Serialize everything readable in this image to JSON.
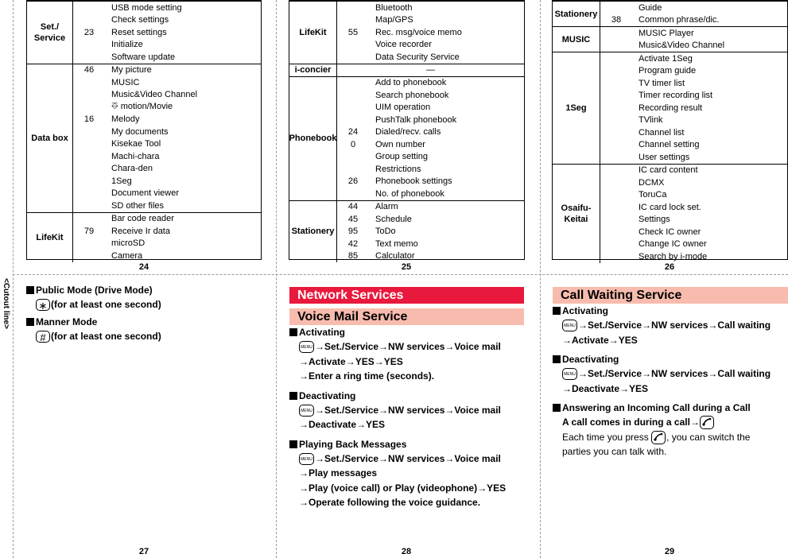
{
  "side_label": "<Cutout line>",
  "pages": {
    "p24": {
      "number": "24",
      "groups": [
        {
          "category": "Set./\nService",
          "rows": [
            {
              "num": "",
              "item": "USB mode setting"
            },
            {
              "num": "",
              "item": "Check settings"
            },
            {
              "num": "23",
              "item": "Reset settings"
            },
            {
              "num": "",
              "item": "Initialize"
            },
            {
              "num": "",
              "item": "Software update"
            }
          ]
        },
        {
          "category": "Data box",
          "rows": [
            {
              "num": "46",
              "item": "My picture"
            },
            {
              "num": "",
              "item": "MUSIC"
            },
            {
              "num": "",
              "item": "Music&Video Channel"
            },
            {
              "num": "",
              "item": "⎑ motion/Movie"
            },
            {
              "num": "16",
              "item": "Melody"
            },
            {
              "num": "",
              "item": "My documents"
            },
            {
              "num": "",
              "item": "Kisekae Tool"
            },
            {
              "num": "",
              "item": "Machi-chara"
            },
            {
              "num": "",
              "item": "Chara-den"
            },
            {
              "num": "",
              "item": "1Seg"
            },
            {
              "num": "",
              "item": "Document viewer"
            },
            {
              "num": "",
              "item": "SD other files"
            }
          ]
        },
        {
          "category": "LifeKit",
          "rows": [
            {
              "num": "",
              "item": "Bar code reader"
            },
            {
              "num": "79",
              "item": "Receive Ir data"
            },
            {
              "num": "",
              "item": "microSD"
            },
            {
              "num": "",
              "item": "Camera"
            }
          ]
        }
      ]
    },
    "p25": {
      "number": "25",
      "groups": [
        {
          "category": "LifeKit",
          "rows": [
            {
              "num": "",
              "item": "Bluetooth"
            },
            {
              "num": "",
              "item": "Map/GPS"
            },
            {
              "num": "55",
              "item": "Rec. msg/voice memo"
            },
            {
              "num": "",
              "item": "Voice recorder"
            },
            {
              "num": "",
              "item": "Data Security Service"
            }
          ]
        },
        {
          "category": "i-concier",
          "dash": "—"
        },
        {
          "category": "Phonebook",
          "rows": [
            {
              "num": "",
              "item": "Add to phonebook"
            },
            {
              "num": "",
              "item": "Search phonebook"
            },
            {
              "num": "",
              "item": "UIM operation"
            },
            {
              "num": "",
              "item": "PushTalk phonebook"
            },
            {
              "num": "24",
              "item": "Dialed/recv. calls"
            },
            {
              "num": "0",
              "item": "Own number"
            },
            {
              "num": "",
              "item": "Group setting"
            },
            {
              "num": "",
              "item": "Restrictions"
            },
            {
              "num": "26",
              "item": "Phonebook settings"
            },
            {
              "num": "",
              "item": "No. of phonebook"
            }
          ]
        },
        {
          "category": "Stationery",
          "rows": [
            {
              "num": "44",
              "item": "Alarm"
            },
            {
              "num": "45",
              "item": "Schedule"
            },
            {
              "num": "95",
              "item": "ToDo"
            },
            {
              "num": "42",
              "item": "Text memo"
            },
            {
              "num": "85",
              "item": "Calculator"
            }
          ]
        }
      ]
    },
    "p26": {
      "number": "26",
      "groups": [
        {
          "category": "Stationery",
          "rows": [
            {
              "num": "",
              "item": "Guide"
            },
            {
              "num": "38",
              "item": "Common phrase/dic."
            }
          ]
        },
        {
          "category": "MUSIC",
          "rows": [
            {
              "num": "",
              "item": "MUSIC Player"
            },
            {
              "num": "",
              "item": "Music&Video Channel"
            }
          ]
        },
        {
          "category": "1Seg",
          "rows": [
            {
              "num": "",
              "item": "Activate 1Seg"
            },
            {
              "num": "",
              "item": "Program guide"
            },
            {
              "num": "",
              "item": "TV timer list"
            },
            {
              "num": "",
              "item": "Timer recording list"
            },
            {
              "num": "",
              "item": "Recording result"
            },
            {
              "num": "",
              "item": "TVlink"
            },
            {
              "num": "",
              "item": "Channel list"
            },
            {
              "num": "",
              "item": "Channel setting"
            },
            {
              "num": "",
              "item": "User settings"
            }
          ]
        },
        {
          "category": "Osaifu-\nKeitai",
          "rows": [
            {
              "num": "",
              "item": "IC card content"
            },
            {
              "num": "",
              "item": "DCMX"
            },
            {
              "num": "",
              "item": "ToruCa"
            },
            {
              "num": "",
              "item": "IC card lock set."
            },
            {
              "num": "",
              "item": "Settings"
            },
            {
              "num": "",
              "item": "Check IC owner"
            },
            {
              "num": "",
              "item": "Change IC owner"
            },
            {
              "num": "",
              "item": "Search by i-mode"
            }
          ]
        }
      ]
    },
    "p27": {
      "number": "27",
      "public_mode": {
        "title": "Public Mode (Drive Mode)",
        "key": "∗",
        "text": "(for at least one second)"
      },
      "manner_mode": {
        "title": "Manner Mode",
        "key": "#",
        "text": "(for at least one second)"
      }
    },
    "p28": {
      "number": "28",
      "section_title": "Network Services",
      "subsection_title": "Voice Mail Service",
      "menu_key": "MENU",
      "activating": {
        "title": "Activating",
        "line1": "→Set./Service→NW services→Voice mail",
        "line2": "→Activate→YES→YES",
        "line3": "→Enter a ring time (seconds)."
      },
      "deactivating": {
        "title": "Deactivating",
        "line1": "→Set./Service→NW services→Voice mail",
        "line2": "→Deactivate→YES"
      },
      "playback": {
        "title": "Playing Back Messages",
        "line1": "→Set./Service→NW services→Voice mail",
        "line2": "→Play messages",
        "line3": "→Play (voice call) or Play (videophone)→YES",
        "line4": "→Operate following the voice guidance."
      }
    },
    "p29": {
      "number": "29",
      "section_title": "Call Waiting Service",
      "menu_key": "MENU",
      "activating": {
        "title": "Activating",
        "line1": "→Set./Service→NW services→Call waiting",
        "line2": "→Activate→YES"
      },
      "deactivating": {
        "title": "Deactivating",
        "line1": "→Set./Service→NW services→Call waiting",
        "line2": "→Deactivate→YES"
      },
      "answering": {
        "title": "Answering an Incoming Call during a Call",
        "line1": "A call comes in during a call→",
        "line2a": "Each time you press ",
        "line2b": ", you can switch the",
        "line3": "parties you can talk with."
      }
    }
  },
  "colors": {
    "section_red": "#e8193c",
    "section_pink": "#f8bcae"
  }
}
